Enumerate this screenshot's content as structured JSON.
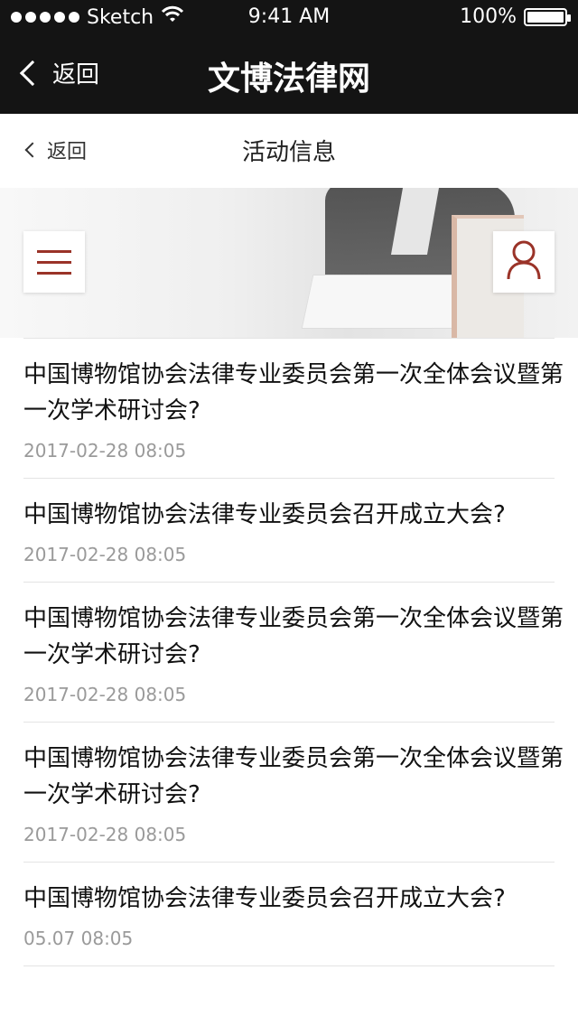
{
  "status_bar": {
    "carrier": "Sketch",
    "time": "9:41 AM",
    "battery": "100%"
  },
  "top_nav": {
    "back_label": "返回",
    "title": "文博法律网"
  },
  "sub_nav": {
    "back_label": "返回",
    "title": "活动信息"
  },
  "icons": {
    "menu": "menu-icon",
    "user": "user-icon",
    "wifi": "wifi-icon",
    "battery": "battery-icon",
    "back": "chevron-left-icon"
  },
  "colors": {
    "topbar": "#141414",
    "accent": "#9a3328",
    "date_text": "#9a9a9a"
  },
  "articles": [
    {
      "title": "中国博物馆协会法律专业委员会第一次全体会议暨第一次学术研讨会?",
      "date": "2017-02-28 08:05"
    },
    {
      "title": "中国博物馆协会法律专业委员会召开成立大会?",
      "date": "2017-02-28 08:05"
    },
    {
      "title": "中国博物馆协会法律专业委员会第一次全体会议暨第一次学术研讨会?",
      "date": "2017-02-28 08:05"
    },
    {
      "title": "中国博物馆协会法律专业委员会第一次全体会议暨第一次学术研讨会?",
      "date": "2017-02-28 08:05"
    },
    {
      "title": "中国博物馆协会法律专业委员会召开成立大会?",
      "date": "05.07 08:05"
    }
  ]
}
